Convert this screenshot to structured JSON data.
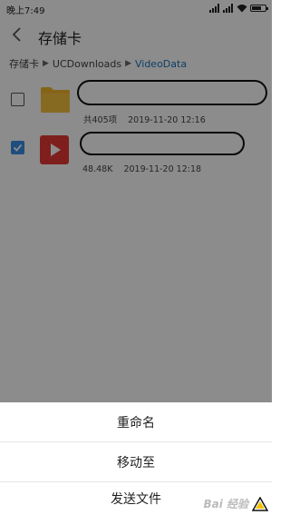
{
  "status_bar": {
    "time": "晚上7:49"
  },
  "header": {
    "title": "存储卡"
  },
  "breadcrumb": {
    "root": "存储卡",
    "middle": "UCDownloads",
    "current": "VideoData"
  },
  "files": [
    {
      "type": "folder",
      "checked": false,
      "meta_size": "共405项",
      "meta_date": "2019-11-20 12:16"
    },
    {
      "type": "video",
      "checked": true,
      "meta_size": "48.48K",
      "meta_date": "2019-11-20 12:18"
    }
  ],
  "sheet": {
    "rename": "重命名",
    "move": "移动至",
    "send": "发送文件"
  },
  "watermark": {
    "text": "Bai 经验"
  },
  "colors": {
    "accent": "#3a8ee6",
    "breadcrumb_current": "#1a74b8",
    "video_icon": "#e53935",
    "folder_icon": "#f3b72d"
  }
}
